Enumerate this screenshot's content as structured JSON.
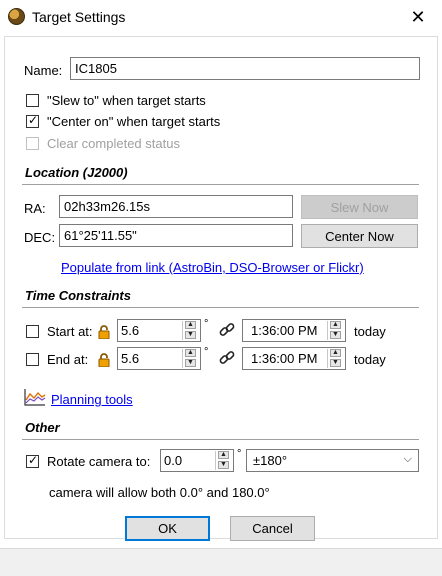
{
  "window": {
    "title": "Target Settings"
  },
  "name": {
    "label": "Name:",
    "value": "IC1805"
  },
  "options": {
    "slew_to": {
      "label": "\"Slew to\" when target starts",
      "checked": false
    },
    "center_on": {
      "label": "\"Center on\" when target starts",
      "checked": true
    },
    "clear_completed": {
      "label": "Clear completed status",
      "checked": false,
      "disabled": true
    }
  },
  "location": {
    "title": "Location (J2000)",
    "ra_label": "RA:",
    "ra_value": "02h33m26.15s",
    "dec_label": "DEC:",
    "dec_value": "61°25'11.55\"",
    "slew_now": "Slew Now",
    "center_now": "Center Now",
    "populate_link": "Populate from link (AstroBin, DSO-Browser or Flickr)"
  },
  "time": {
    "title": "Time Constraints",
    "start_label": "Start at:",
    "start_alt": "5.6",
    "start_time": "1:36:00 PM",
    "start_day": "today",
    "end_label": "End at:",
    "end_alt": "5.6",
    "end_time": "1:36:00 PM",
    "end_day": "today",
    "degree": "°",
    "planning_link": "Planning tools"
  },
  "other": {
    "title": "Other",
    "rotate_label": "Rotate camera to:",
    "rotate_value": "0.0",
    "rotate_checked": true,
    "range_option": "±180°",
    "note": "camera will allow both 0.0° and 180.0°"
  },
  "buttons": {
    "ok": "OK",
    "cancel": "Cancel"
  },
  "icons": {
    "lock": "lock-icon",
    "link": "chain-link-icon",
    "chart": "chart-icon",
    "close": "close-icon"
  }
}
